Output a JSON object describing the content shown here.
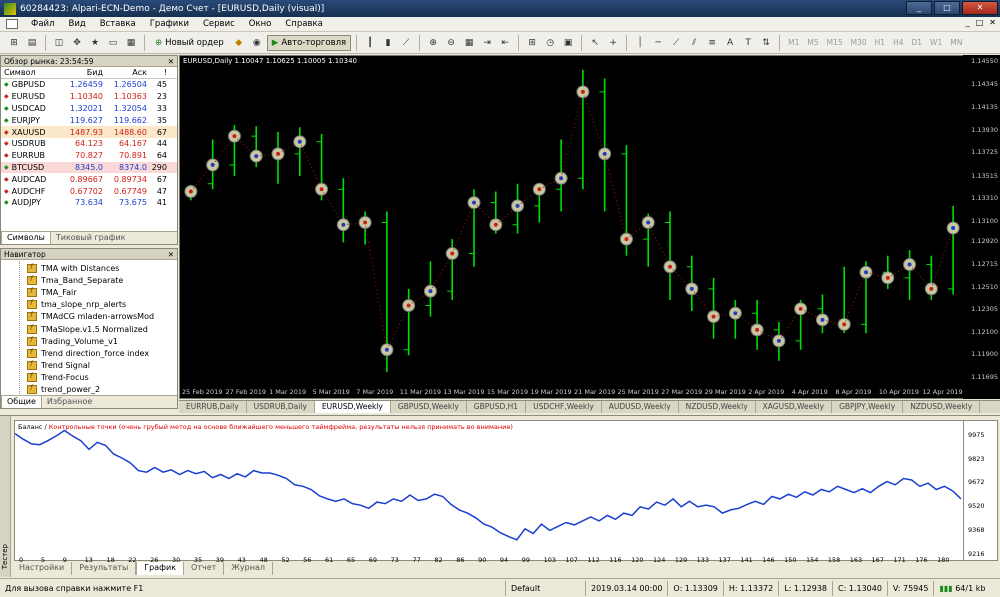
{
  "window": {
    "title": "60284423: Alpari-ECN-Demo - Демо Счет - [EURUSD,Daily (visual)]",
    "buttons": [
      "_",
      "□",
      "✕"
    ]
  },
  "menu": {
    "items": [
      "Файл",
      "Вид",
      "Вставка",
      "Графики",
      "Сервис",
      "Окно",
      "Справка"
    ],
    "mdi_buttons": [
      "_",
      "□",
      "✕"
    ]
  },
  "toolbar": {
    "new_order": "Новый ордер",
    "auto_trading": "Авто-торговля",
    "timeframes": [
      "M1",
      "M5",
      "M15",
      "M30",
      "H1",
      "H4",
      "D1",
      "W1",
      "MN"
    ]
  },
  "market_watch": {
    "title": "Обзор рынка: 23:54:59",
    "columns": [
      "Символ",
      "Бид",
      "Аск",
      "!"
    ],
    "rows": [
      {
        "symbol": "GBPUSD",
        "bid": "1.26459",
        "ask": "1.26504",
        "spread": "45",
        "dir": "up"
      },
      {
        "symbol": "EURUSD",
        "bid": "1.10340",
        "ask": "1.10363",
        "spread": "23",
        "dir": "down"
      },
      {
        "symbol": "USDCAD",
        "bid": "1.32021",
        "ask": "1.32054",
        "spread": "33",
        "dir": "up"
      },
      {
        "symbol": "EURJPY",
        "bid": "119.627",
        "ask": "119.662",
        "spread": "35",
        "dir": "up"
      },
      {
        "symbol": "XAUUSD",
        "bid": "1487.93",
        "ask": "1488.60",
        "spread": "67",
        "dir": "down"
      },
      {
        "symbol": "USDRUB",
        "bid": "64.123",
        "ask": "64.167",
        "spread": "44",
        "dir": "down"
      },
      {
        "symbol": "EURRUB",
        "bid": "70.827",
        "ask": "70.891",
        "spread": "64",
        "dir": "down"
      },
      {
        "symbol": "BTCUSD",
        "bid": "8345.0",
        "ask": "8374.0",
        "spread": "290",
        "dir": "up"
      },
      {
        "symbol": "AUDCAD",
        "bid": "0.89667",
        "ask": "0.89734",
        "spread": "67",
        "dir": "down"
      },
      {
        "symbol": "AUDCHF",
        "bid": "0.67702",
        "ask": "0.67749",
        "spread": "47",
        "dir": "down"
      },
      {
        "symbol": "AUDJPY",
        "bid": "73.634",
        "ask": "73.675",
        "spread": "41",
        "dir": "up"
      }
    ],
    "tabs": [
      "Символы",
      "Тиковый график"
    ]
  },
  "navigator": {
    "title": "Навигатор",
    "items": [
      "TMA with Distances",
      "Tma_Band_Separate",
      "TMA_Fair",
      "tma_slope_nrp_alerts",
      "TMAdCG mladen-arrowsMod",
      "TMaSlope.v1.5 Normalized",
      "Trading_Volume_v1",
      "Trend direction_force index",
      "Trend Signal",
      "Trend-Focus",
      "trend_power_2"
    ],
    "tabs": [
      "Общие",
      "Избранное"
    ]
  },
  "chart": {
    "label": "EURUSD,Daily  1.10047 1.10625 1.10005 1.10340",
    "price_labels": [
      "1.14550",
      "1.14345",
      "1.14135",
      "1.13930",
      "1.13725",
      "1.13515",
      "1.13310",
      "1.13100",
      "1.12920",
      "1.12715",
      "1.12510",
      "1.12305",
      "1.12100",
      "1.11900",
      "1.11695"
    ],
    "time_labels": [
      "25 Feb 2019",
      "27 Feb 2019",
      "1 Mar 2019",
      "5 Mar 2019",
      "7 Mar 2019",
      "11 Mar 2019",
      "13 Mar 2019",
      "15 Mar 2019",
      "19 Mar 2019",
      "21 Mar 2019",
      "25 Mar 2019",
      "27 Mar 2019",
      "29 Mar 2019",
      "2 Apr 2019",
      "4 Apr 2019",
      "8 Apr 2019",
      "10 Apr 2019",
      "12 Apr 2019"
    ],
    "tabs": [
      "EURRUB,Daily",
      "USDRUB,Daily",
      "EURUSD,Weekly",
      "GBPUSD,Weekly",
      "GBPUSD,H1",
      "USDCHF,Weekly",
      "AUDUSD,Weekly",
      "NZDUSD,Weekly",
      "XAGUSD,Weekly",
      "GBPJPY,Weekly",
      "NZDUSD,Weekly"
    ],
    "active_tab": 2,
    "colors": {
      "bull": "#00e000",
      "bear": "#00e000",
      "marker": "#c8c8a0"
    },
    "candles": [
      {
        "o": 1.1336,
        "h": 1.1344,
        "l": 1.133,
        "c": 1.1338
      },
      {
        "o": 1.1345,
        "h": 1.1385,
        "l": 1.134,
        "c": 1.1362
      },
      {
        "o": 1.1362,
        "h": 1.1398,
        "l": 1.1352,
        "c": 1.1388
      },
      {
        "o": 1.1388,
        "h": 1.1397,
        "l": 1.136,
        "c": 1.137
      },
      {
        "o": 1.137,
        "h": 1.1392,
        "l": 1.1345,
        "c": 1.1372
      },
      {
        "o": 1.1372,
        "h": 1.1396,
        "l": 1.1352,
        "c": 1.1383
      },
      {
        "o": 1.1383,
        "h": 1.139,
        "l": 1.133,
        "c": 1.134
      },
      {
        "o": 1.134,
        "h": 1.135,
        "l": 1.1292,
        "c": 1.1308
      },
      {
        "o": 1.1308,
        "h": 1.132,
        "l": 1.129,
        "c": 1.131
      },
      {
        "o": 1.131,
        "h": 1.132,
        "l": 1.1175,
        "c": 1.1195
      },
      {
        "o": 1.1195,
        "h": 1.125,
        "l": 1.119,
        "c": 1.1235
      },
      {
        "o": 1.1235,
        "h": 1.1275,
        "l": 1.1225,
        "c": 1.1248
      },
      {
        "o": 1.1248,
        "h": 1.1295,
        "l": 1.124,
        "c": 1.1282
      },
      {
        "o": 1.1282,
        "h": 1.134,
        "l": 1.127,
        "c": 1.1328
      },
      {
        "o": 1.1328,
        "h": 1.1338,
        "l": 1.13,
        "c": 1.1308
      },
      {
        "o": 1.1308,
        "h": 1.1345,
        "l": 1.13,
        "c": 1.1325
      },
      {
        "o": 1.1325,
        "h": 1.1345,
        "l": 1.131,
        "c": 1.134
      },
      {
        "o": 1.134,
        "h": 1.1385,
        "l": 1.132,
        "c": 1.135
      },
      {
        "o": 1.135,
        "h": 1.1448,
        "l": 1.134,
        "c": 1.1428
      },
      {
        "o": 1.1428,
        "h": 1.144,
        "l": 1.132,
        "c": 1.1372
      },
      {
        "o": 1.1372,
        "h": 1.138,
        "l": 1.128,
        "c": 1.1295
      },
      {
        "o": 1.1295,
        "h": 1.1318,
        "l": 1.127,
        "c": 1.131
      },
      {
        "o": 1.131,
        "h": 1.132,
        "l": 1.124,
        "c": 1.127
      },
      {
        "o": 1.127,
        "h": 1.128,
        "l": 1.123,
        "c": 1.125
      },
      {
        "o": 1.125,
        "h": 1.126,
        "l": 1.1205,
        "c": 1.1225
      },
      {
        "o": 1.1225,
        "h": 1.124,
        "l": 1.1205,
        "c": 1.1228
      },
      {
        "o": 1.1228,
        "h": 1.124,
        "l": 1.1195,
        "c": 1.1213
      },
      {
        "o": 1.1213,
        "h": 1.122,
        "l": 1.1185,
        "c": 1.1203
      },
      {
        "o": 1.1203,
        "h": 1.124,
        "l": 1.1195,
        "c": 1.1232
      },
      {
        "o": 1.1232,
        "h": 1.1245,
        "l": 1.121,
        "c": 1.1222
      },
      {
        "o": 1.1222,
        "h": 1.127,
        "l": 1.121,
        "c": 1.1218
      },
      {
        "o": 1.1218,
        "h": 1.1275,
        "l": 1.121,
        "c": 1.1265
      },
      {
        "o": 1.1265,
        "h": 1.128,
        "l": 1.125,
        "c": 1.126
      },
      {
        "o": 1.126,
        "h": 1.1285,
        "l": 1.124,
        "c": 1.1272
      },
      {
        "o": 1.1272,
        "h": 1.128,
        "l": 1.124,
        "c": 1.125
      },
      {
        "o": 1.125,
        "h": 1.1325,
        "l": 1.1245,
        "c": 1.1305
      }
    ]
  },
  "tester": {
    "side_label": "Тестер",
    "legend_label": "Баланс",
    "legend_note": "Контрольные точки (очень грубый метод на основе ближайшего меньшего таймфрейма, результаты нельзя принимать во внимание)",
    "price_labels": [
      "9975",
      "9823",
      "9672",
      "9520",
      "9368",
      "9216"
    ],
    "trade_numbers": [
      "0",
      "5",
      "9",
      "13",
      "18",
      "22",
      "26",
      "30",
      "35",
      "39",
      "43",
      "48",
      "52",
      "56",
      "61",
      "65",
      "69",
      "73",
      "77",
      "82",
      "86",
      "90",
      "94",
      "99",
      "103",
      "107",
      "112",
      "116",
      "120",
      "124",
      "129",
      "133",
      "137",
      "141",
      "146",
      "150",
      "154",
      "158",
      "163",
      "167",
      "171",
      "176",
      "180"
    ],
    "ylim": [
      9216,
      10030
    ],
    "balance_series": [
      9975,
      9940,
      9910,
      9905,
      9930,
      9960,
      9995,
      9960,
      9930,
      9875,
      9920,
      9900,
      9845,
      9820,
      9790,
      9740,
      9730,
      9760,
      9730,
      9745,
      9715,
      9740,
      9720,
      9735,
      9695,
      9715,
      9690,
      9720,
      9700,
      9740,
      9725,
      9725,
      9710,
      9690,
      9650,
      9640,
      9620,
      9580,
      9560,
      9545,
      9560,
      9530,
      9520,
      9500,
      9540,
      9530,
      9560,
      9545,
      9585,
      9550,
      9560,
      9590,
      9575,
      9525,
      9490,
      9470,
      9440,
      9400,
      9380,
      9345,
      9320,
      9300,
      9370,
      9340,
      9400,
      9360,
      9385,
      9410,
      9395,
      9420,
      9445,
      9420,
      9455,
      9430,
      9470,
      9455,
      9510,
      9495,
      9540,
      9520,
      9560,
      9510,
      9545,
      9510,
      9520,
      9510,
      9470,
      9490,
      9500,
      9525,
      9545,
      9525,
      9575,
      9560,
      9590,
      9570,
      9605,
      9585,
      9620,
      9605,
      9640,
      9620,
      9600,
      9625,
      9600,
      9640,
      9670,
      9650,
      9690,
      9680,
      9640,
      9660,
      9620,
      9640,
      9610,
      9560
    ],
    "tabs": [
      "Настройки",
      "Результаты",
      "График",
      "Отчет",
      "Журнал"
    ],
    "active_tab": 2
  },
  "status": {
    "help": "Для вызова справки нажмите F1",
    "profile": "Default",
    "datetime": "2019.03.14 00:00",
    "open": "O: 1.13309",
    "high": "H: 1.13372",
    "low": "L: 1.12938",
    "close": "C: 1.13040",
    "volume": "V: 75945",
    "traffic": "64/1 kb"
  }
}
